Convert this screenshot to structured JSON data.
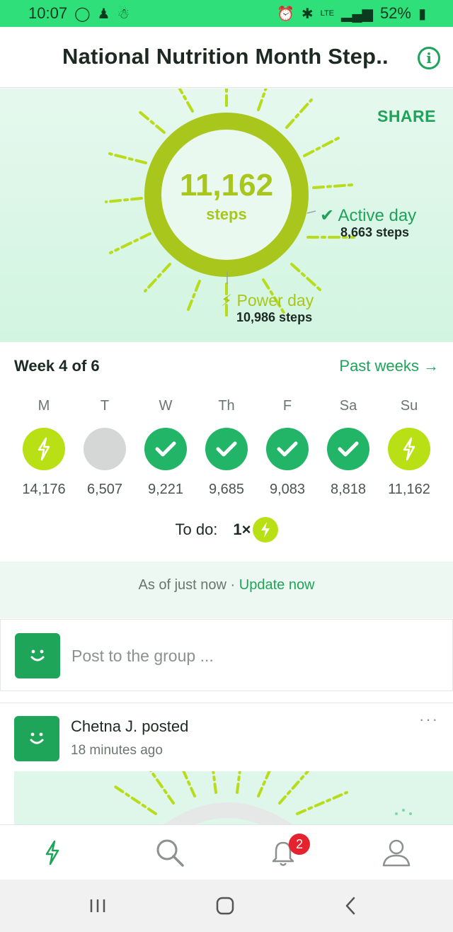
{
  "status": {
    "time": "10:07",
    "battery": "52%",
    "network": "LTE"
  },
  "header": {
    "title": "National Nutrition Month Step..",
    "info_icon": "info-icon"
  },
  "hero": {
    "share_label": "SHARE",
    "steps_value": "11,162",
    "steps_label": "steps",
    "active_label": "Active day",
    "active_steps": "8,663 steps",
    "power_label": "Power day",
    "power_steps": "10,986 steps"
  },
  "week": {
    "title": "Week 4 of 6",
    "past_weeks_label": "Past weeks →",
    "days": [
      {
        "label": "M",
        "status": "power",
        "steps": "14,176"
      },
      {
        "label": "T",
        "status": "none",
        "steps": "6,507"
      },
      {
        "label": "W",
        "status": "done",
        "steps": "9,221"
      },
      {
        "label": "Th",
        "status": "done",
        "steps": "9,685"
      },
      {
        "label": "F",
        "status": "done",
        "steps": "9,083"
      },
      {
        "label": "Sa",
        "status": "done",
        "steps": "8,818"
      },
      {
        "label": "Su",
        "status": "power",
        "steps": "11,162"
      }
    ],
    "todo_label": "To do:",
    "todo_count": "1×"
  },
  "sync": {
    "as_of": "As of just now · ",
    "update_label": "Update now"
  },
  "composer": {
    "placeholder": "Post to the group ..."
  },
  "feed": {
    "author_line": "Chetna J. posted",
    "time": "18 minutes ago",
    "more_label": "···"
  },
  "tabs": {
    "notifications_badge": "2"
  },
  "colors": {
    "brand_green": "#1fa35a",
    "power_lime": "#b9e015",
    "ring": "#a9c61c",
    "status_bar": "#2fe07a"
  }
}
